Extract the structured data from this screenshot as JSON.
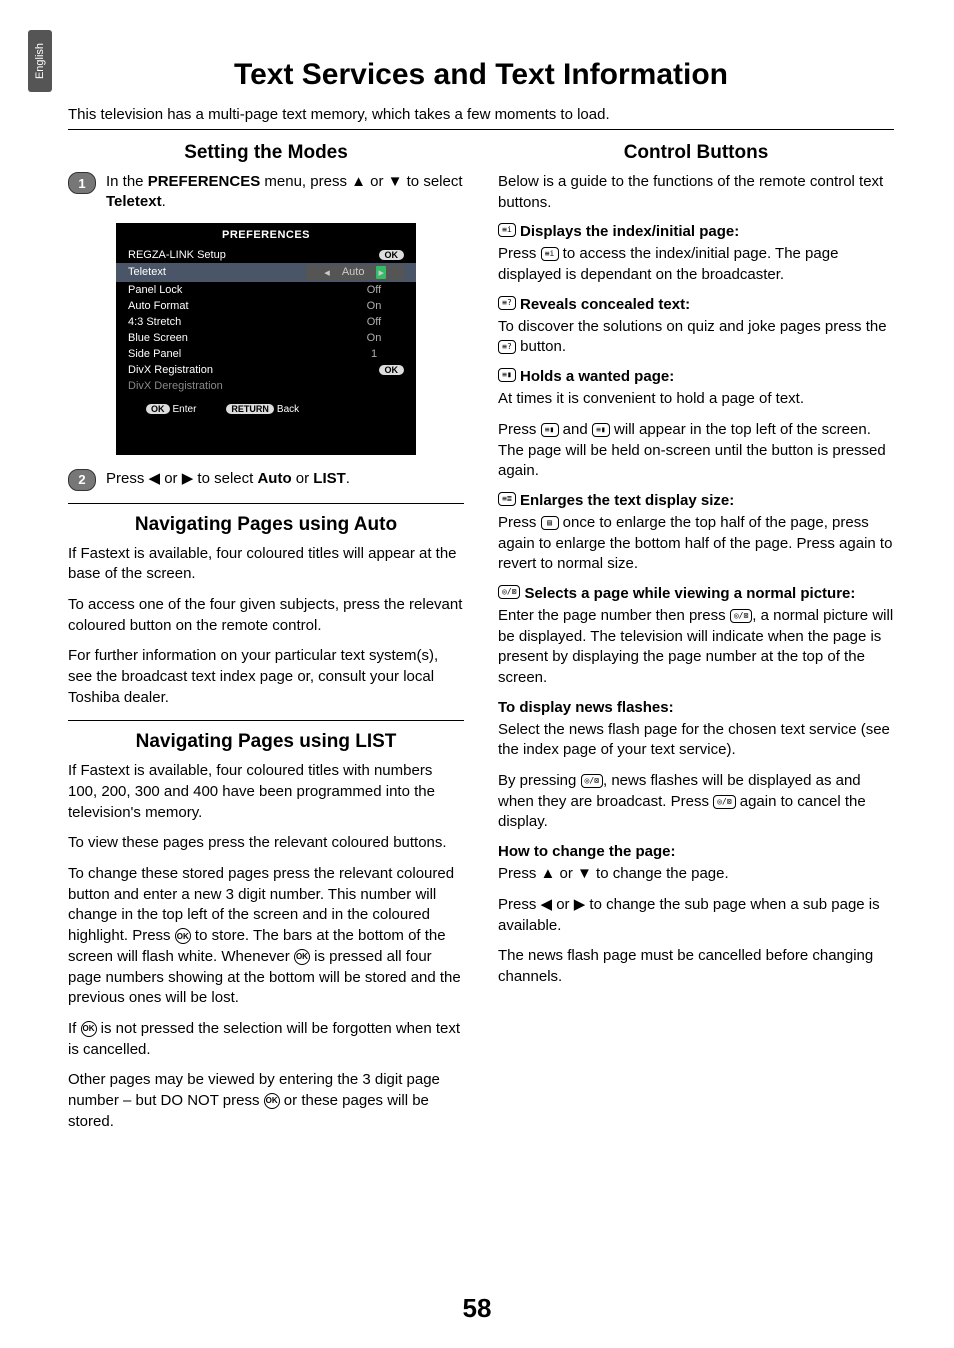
{
  "side_tab": "English",
  "page_title": "Text Services and Text Information",
  "intro": "This television has a multi-page text memory, which takes a few moments to load.",
  "left": {
    "h_setting": "Setting the Modes",
    "step1_pre": "In the ",
    "step1_bold1": "PREFERENCES",
    "step1_mid": " menu, press ▲ or ▼ to select ",
    "step1_bold2": "Teletext",
    "step1_post": ".",
    "tv": {
      "title": "PREFERENCES",
      "rows": [
        {
          "label": "REGZA-LINK Setup",
          "value": "OK",
          "pill": true
        },
        {
          "label": "Teletext",
          "value": "Auto",
          "selected": true
        },
        {
          "label": "Panel Lock",
          "value": "Off"
        },
        {
          "label": "Auto Format",
          "value": "On"
        },
        {
          "label": "4:3 Stretch",
          "value": "Off"
        },
        {
          "label": "Blue Screen",
          "value": "On"
        },
        {
          "label": "Side Panel",
          "value": "1"
        },
        {
          "label": "DivX Registration",
          "value": "OK",
          "pill": true
        },
        {
          "label": "DivX Deregistration",
          "value": ""
        }
      ],
      "footer": [
        {
          "pill": "OK",
          "text": "Enter"
        },
        {
          "pill": "RETURN",
          "text": "Back"
        }
      ]
    },
    "step2_pre": "Press ◀ or ▶ to select ",
    "step2_b1": "Auto",
    "step2_mid": " or ",
    "step2_b2": "LIST",
    "step2_post": ".",
    "h_auto": "Navigating Pages using Auto",
    "auto_p1": "If Fastext is available, four coloured titles will appear at the base of the screen.",
    "auto_p2": "To access one of the four given subjects, press the relevant coloured button on the remote control.",
    "auto_p3": "For further information on your particular text system(s), see the broadcast text index page or, consult your local Toshiba dealer.",
    "h_list": "Navigating Pages using LIST",
    "list_p1": "If Fastext is available, four coloured titles with numbers 100, 200, 300 and 400 have been programmed into the television's memory.",
    "list_p2": "To view these pages press the relevant coloured buttons.",
    "list_p3a": "To change these stored pages press the relevant coloured button and enter a new 3 digit number. This number will change in the top left of the screen and in the coloured highlight. Press ",
    "list_p3b": " to store. The bars at the bottom of the screen will flash white. Whenever ",
    "list_p3c": " is pressed all four page numbers showing at the bottom will be stored and the previous ones will be lost.",
    "list_p4a": "If ",
    "list_p4b": " is not pressed the selection will be forgotten when text is cancelled.",
    "list_p5a": "Other pages may be viewed by entering the 3 digit page number – but DO NOT press ",
    "list_p5b": " or these pages will be stored."
  },
  "right": {
    "h_control": "Control Buttons",
    "cb_intro": "Below is a guide to the functions of the remote control text buttons.",
    "sub1": "Displays the index/initial page:",
    "sub1_icon": "≡i",
    "p1a": "Press ",
    "p1b": " to access the index/initial page. The page displayed is dependant on the broadcaster.",
    "sub2": "Reveals concealed text:",
    "sub2_icon": "≡?",
    "p2a": "To discover the solutions on quiz and joke pages press the ",
    "p2b": " button.",
    "sub3": "Holds a wanted page:",
    "sub3_icon": "≡▮",
    "p3": "At times it is convenient to hold a page of text.",
    "p3b_a": "Press ",
    "p3b_b": " and ",
    "p3b_c": " will appear in the top left of the screen. The page will be held on-screen until the button is pressed again.",
    "sub4": "Enlarges the text display size:",
    "sub4_icon": "≡≣",
    "p4a": "Press ",
    "p4a_icon": "▤",
    "p4b": " once to enlarge the top half of the page, press again to enlarge the bottom half of the page. Press again to revert to normal size.",
    "sub5": "Selects a page while viewing a normal picture:",
    "sub5_icon": "◎/⊠",
    "p5a": "Enter the page number then press ",
    "p5b": ", a normal picture will be displayed. The television will indicate when the page is present by displaying the page number at the top of the screen.",
    "sub6": "To display news flashes:",
    "p6": "Select the news flash page for the chosen text service (see the index page of your text service).",
    "p7a": "By pressing ",
    "p7b": ", news flashes will be displayed as and when they are broadcast. Press ",
    "p7c": " again to cancel the display.",
    "sub7": "How to change the page:",
    "p8": "Press ▲ or ▼ to change the page.",
    "p9": "Press ◀ or ▶ to change the sub page when a sub page is available.",
    "p10": "The news flash page must be cancelled before changing channels."
  },
  "page_num": "58"
}
